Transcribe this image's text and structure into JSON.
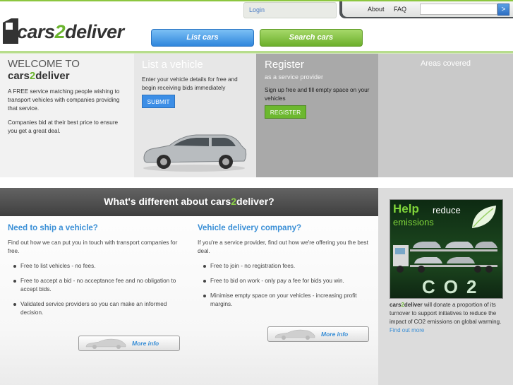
{
  "header": {
    "brand_prefix": "cars",
    "brand_two": "2",
    "brand_suffix": "deliver",
    "login_label": "Login",
    "about_label": "About",
    "faq_label": "FAQ",
    "search_value": "",
    "search_button_glyph": ">"
  },
  "tabs": {
    "list_cars": "List cars",
    "search_cars": "Search cars"
  },
  "welcome": {
    "title": "WELCOME TO",
    "brand_prefix": "cars",
    "brand_two": "2",
    "brand_suffix": "deliver",
    "p1": "A FREE service matching people wishing to transport vehicles with companies providing that service.",
    "p2": "Companies bid at their best price to ensure you get a great deal."
  },
  "list_vehicle": {
    "title": "List a vehicle",
    "text": "Enter your vehicle details for free and begin receiving bids immediately",
    "button": "SUBMIT"
  },
  "register": {
    "title": "Register",
    "subtitle": "as a service provider",
    "text": "Sign up free and fill empty space on your vehicles",
    "button": "REGISTER"
  },
  "areas": {
    "title": "Areas covered"
  },
  "different": {
    "title_prefix": "What's different about cars",
    "title_two": "2",
    "title_suffix": "deliver?"
  },
  "ship": {
    "title": "Need to ship a vehicle?",
    "intro": "Find out how we can put you in touch with transport companies for free.",
    "bullets": [
      "Free to list vehicles - no fees.",
      "Free to accept a bid - no acceptance fee and no obligation to accept bids.",
      "Validated service providers so you can make an informed decision."
    ],
    "more": "More info"
  },
  "delivery": {
    "title": "Vehicle delivery company?",
    "intro": "If you're a service provider, find out how we're offering you the best deal.",
    "bullets": [
      "Free to join - no registration fees.",
      "Free to bid on work - only pay a fee for bids you win.",
      "Minimise empty space on your vehicles - increasing profit margins."
    ],
    "more": "More info"
  },
  "promo": {
    "help": "Help",
    "reduce": "reduce",
    "emissions": "emissions",
    "co2": "CO2",
    "brand_prefix": "cars",
    "brand_two": "2",
    "brand_suffix": "deliver",
    "text": " will donate a proportion of its turnover to support initiatives to reduce the impact of CO2 emissions on global warming. ",
    "link": "Find out more"
  },
  "colors": {
    "accent_green": "#6bb52f",
    "accent_blue": "#3a8fd6",
    "dark_header": "#4f5356"
  }
}
